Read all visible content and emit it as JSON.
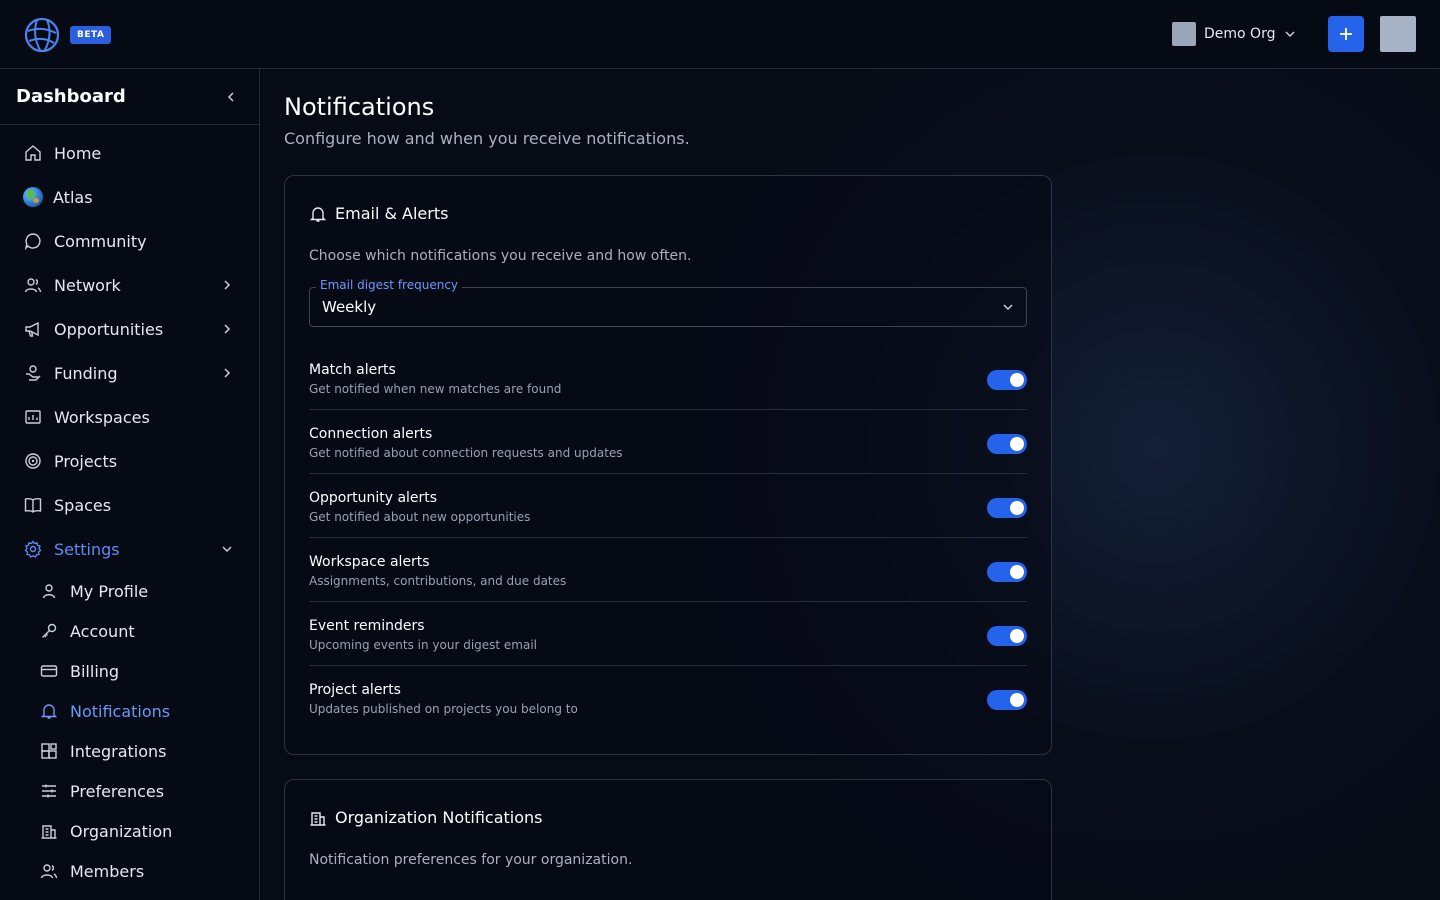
{
  "topbar": {
    "logo_icon": "globe-network-logo",
    "beta_label": "BETA",
    "org_name": "Demo Org",
    "add_icon": "plus-icon",
    "accent": "#2563eb"
  },
  "sidebar": {
    "title": "Dashboard",
    "collapse_icon": "chevron-left-icon",
    "items": [
      {
        "label": "Home",
        "icon": "home-icon"
      },
      {
        "label": "Atlas",
        "icon": "globe-icon"
      },
      {
        "label": "Community",
        "icon": "chat-bubble-icon"
      },
      {
        "label": "Network",
        "icon": "users-icon",
        "has_children": true
      },
      {
        "label": "Opportunities",
        "icon": "megaphone-icon",
        "has_children": true
      },
      {
        "label": "Funding",
        "icon": "funding-icon",
        "has_children": true
      },
      {
        "label": "Workspaces",
        "icon": "workspace-icon"
      },
      {
        "label": "Projects",
        "icon": "target-icon"
      },
      {
        "label": "Spaces",
        "icon": "book-open-icon"
      },
      {
        "label": "Settings",
        "icon": "gear-icon",
        "expanded": true,
        "active": true
      }
    ],
    "settings_items": [
      {
        "label": "My Profile",
        "icon": "user-icon"
      },
      {
        "label": "Account",
        "icon": "key-icon"
      },
      {
        "label": "Billing",
        "icon": "credit-card-icon"
      },
      {
        "label": "Notifications",
        "icon": "bell-icon",
        "active": true
      },
      {
        "label": "Integrations",
        "icon": "integrations-icon"
      },
      {
        "label": "Preferences",
        "icon": "sliders-icon"
      },
      {
        "label": "Organization",
        "icon": "building-icon"
      },
      {
        "label": "Members",
        "icon": "users-icon"
      }
    ]
  },
  "main": {
    "title": "Notifications",
    "subtitle": "Configure how and when you receive notifications.",
    "email_card": {
      "title": "Email & Alerts",
      "icon": "bell-icon",
      "description": "Choose which notifications you receive and how often.",
      "digest_label": "Email digest frequency",
      "digest_value": "Weekly",
      "alerts": [
        {
          "title": "Match alerts",
          "desc": "Get notified when new matches are found",
          "enabled": true
        },
        {
          "title": "Connection alerts",
          "desc": "Get notified about connection requests and updates",
          "enabled": true
        },
        {
          "title": "Opportunity alerts",
          "desc": "Get notified about new opportunities",
          "enabled": true
        },
        {
          "title": "Workspace alerts",
          "desc": "Assignments, contributions, and due dates",
          "enabled": true
        },
        {
          "title": "Event reminders",
          "desc": "Upcoming events in your digest email",
          "enabled": true
        },
        {
          "title": "Project alerts",
          "desc": "Updates published on projects you belong to",
          "enabled": true
        }
      ]
    },
    "org_card": {
      "title": "Organization Notifications",
      "icon": "building-icon",
      "description": "Notification preferences for your organization."
    }
  }
}
